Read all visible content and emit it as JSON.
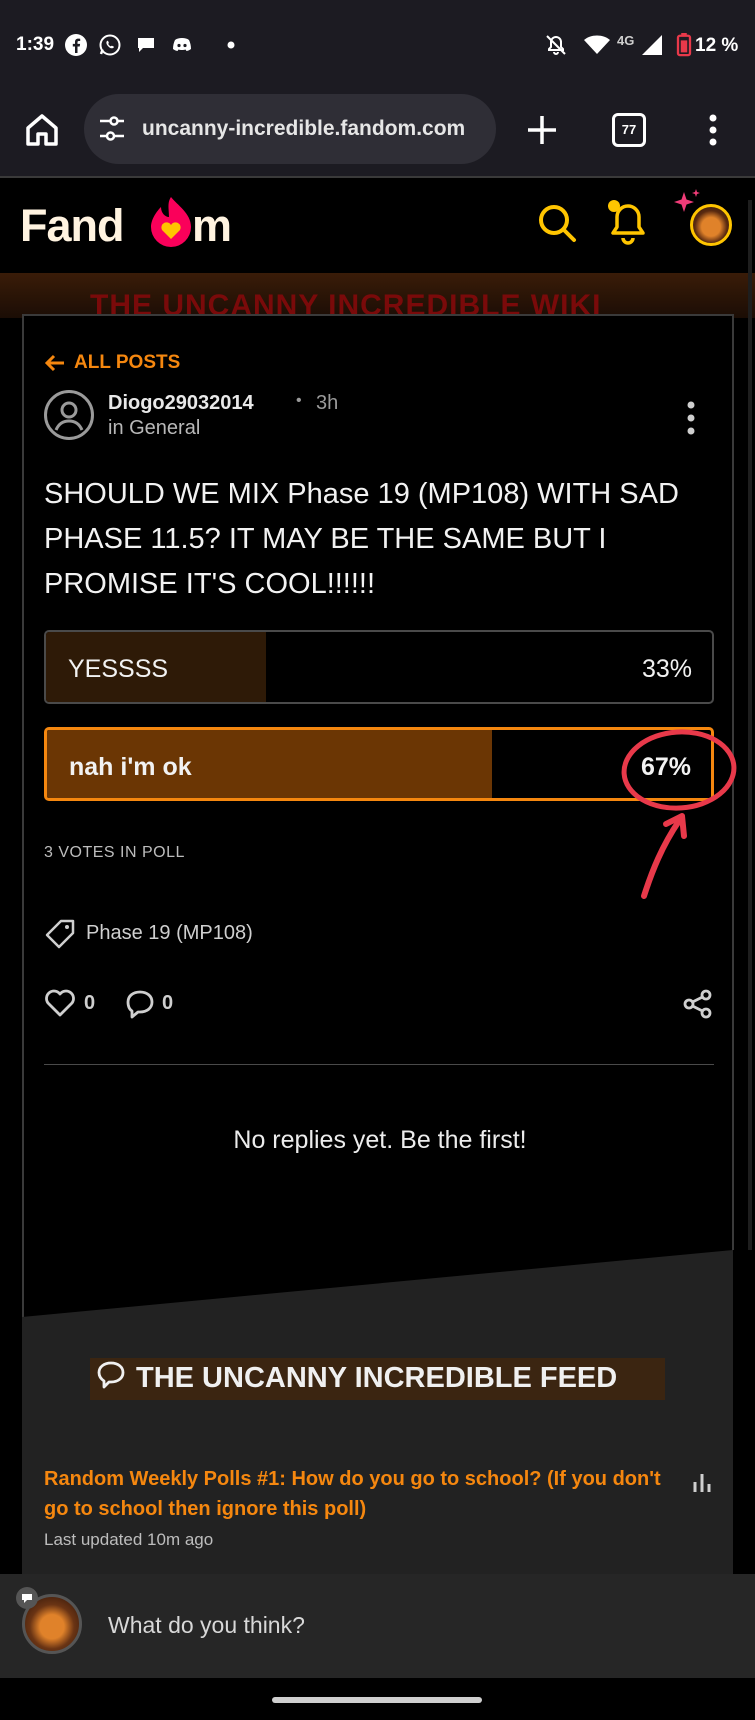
{
  "status_bar": {
    "time": "1:39",
    "network": "4G",
    "battery": "12 %"
  },
  "browser": {
    "url": "uncanny-incredible.fandom.com",
    "tab_count": "77"
  },
  "fandom": {
    "logo_text_a": "Fand",
    "logo_text_b": "m",
    "banner_text": "THE UNCANNY INCREDIBLE WIKI"
  },
  "post": {
    "back_label": "ALL POSTS",
    "author": "Diogo29032014",
    "separator": "•",
    "time_ago": "3h",
    "category": "in General",
    "title": "SHOULD WE MIX Phase 19 (MP108) WITH SAD PHASE 11.5? IT MAY BE THE SAME BUT I PROMISE IT'S COOL!!!!!!",
    "poll": {
      "options": [
        {
          "label": "YESSSS",
          "percent_text": "33%",
          "percent": 33,
          "selected": false
        },
        {
          "label": "nah i'm ok",
          "percent_text": "67%",
          "percent": 67,
          "selected": true
        }
      ],
      "votes_text": "3 VOTES IN POLL"
    },
    "tag": "Phase 19 (MP108)",
    "likes": "0",
    "comments": "0",
    "no_replies": "No replies yet. Be the first!"
  },
  "feed": {
    "title": "THE UNCANNY INCREDIBLE FEED",
    "post_title": "Random Weekly Polls #1: How do you go to school? (If you don't go to school then ignore this poll)",
    "updated": "Last updated 10m ago"
  },
  "composer": {
    "placeholder": "What do you think?"
  },
  "colors": {
    "accent": "#f5870f",
    "annotation": "#e8394a",
    "notification": "#f03c78"
  }
}
